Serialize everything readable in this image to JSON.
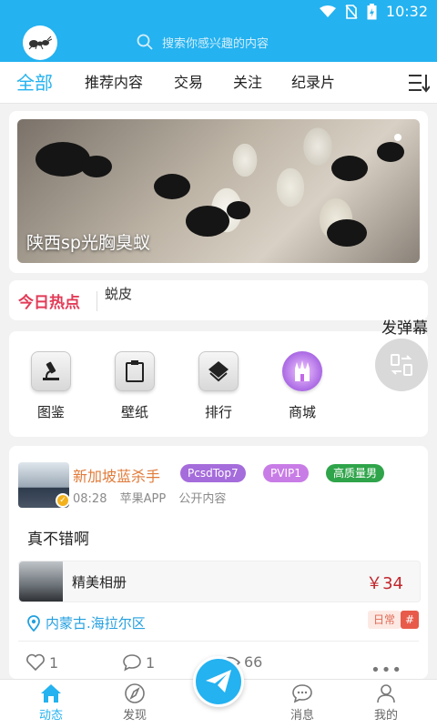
{
  "status_bar": {
    "time": "10:32"
  },
  "header": {
    "logo_alt": "app logo",
    "search": {
      "placeholder": "搜索你感兴趣的内容"
    }
  },
  "tabs": {
    "items": [
      "全部",
      "推荐内容",
      "交易",
      "关注",
      "纪录片"
    ],
    "active": "全部"
  },
  "banner": {
    "caption": "陕西sp光胸臭蚁"
  },
  "hot": {
    "label": "今日热点",
    "item": "蜕皮"
  },
  "danmu": {
    "label": "发弹幕"
  },
  "shortcuts": [
    {
      "label": "图鉴",
      "icon": "microscope-icon"
    },
    {
      "label": "壁纸",
      "icon": "clipboard-icon"
    },
    {
      "label": "排行",
      "icon": "layers-icon"
    },
    {
      "label": "商城",
      "icon": "castle-icon"
    }
  ],
  "post": {
    "username": "新加坡蓝杀手",
    "tags": [
      {
        "text": "PcsdTop7",
        "color": "#a56cdb"
      },
      {
        "text": "PVIP1",
        "color": "#c87ce6"
      },
      {
        "text": "高质量男",
        "color": "#2fa44a"
      }
    ],
    "time": "08:28",
    "source": "苹果APP",
    "visibility": "公开内容",
    "text": "真不错啊",
    "album": {
      "title": "精美相册",
      "price": "￥34"
    },
    "location": "内蒙古.海拉尔区",
    "category": "日常",
    "category_tag": "#",
    "likes": "1",
    "comments": "1",
    "views": "66"
  },
  "bottom_nav": {
    "items": [
      "动态",
      "发现",
      "消息",
      "我的"
    ],
    "active": "动态"
  },
  "colors": {
    "accent": "#24b2f0",
    "hot": "#e23b57",
    "price": "#c1272d"
  }
}
